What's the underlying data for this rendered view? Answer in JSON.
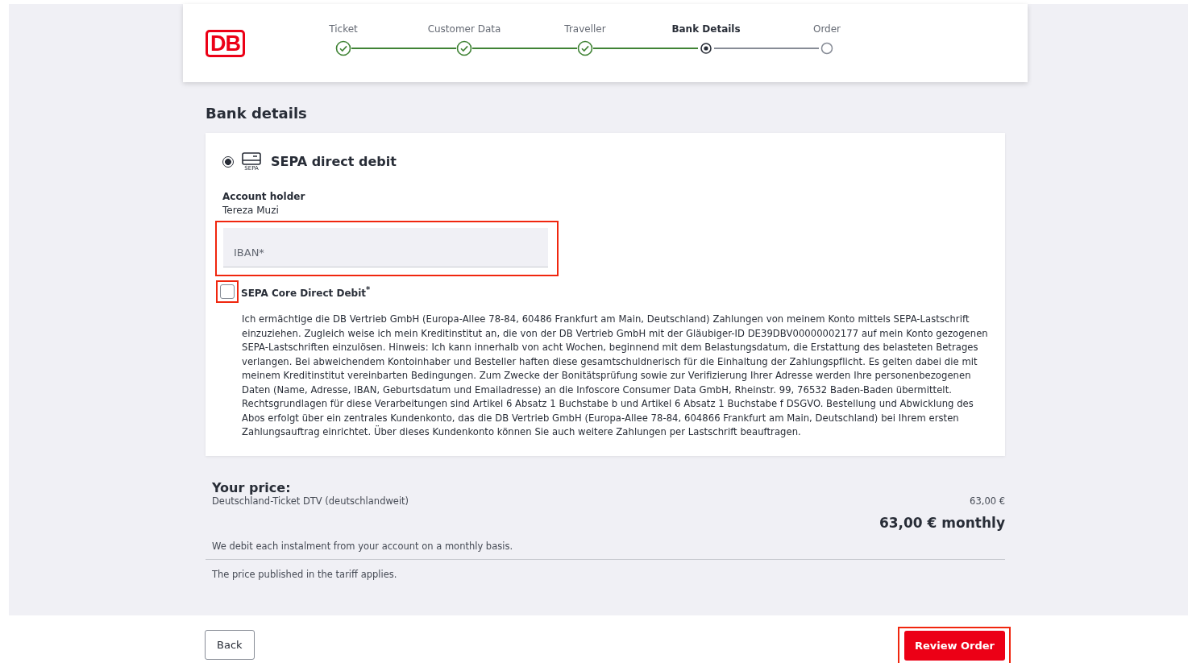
{
  "logo": "DB",
  "steps": [
    {
      "label": "Ticket",
      "completed": true,
      "selected": false
    },
    {
      "label": "Customer Data",
      "completed": true,
      "selected": false
    },
    {
      "label": "Traveller",
      "completed": true,
      "selected": false
    },
    {
      "label": "Bank Details",
      "completed": false,
      "selected": true
    },
    {
      "label": "Order",
      "completed": false,
      "selected": false
    }
  ],
  "heading": "Bank details",
  "payment": {
    "selected": true,
    "icon_caption": "SEPA",
    "label": "SEPA direct debit",
    "holder_label": "Account holder",
    "holder_value": "Tereza Muzi",
    "iban": {
      "placeholder": "IBAN*",
      "highlighted": true
    },
    "mandate": {
      "checked": false,
      "highlighted": true,
      "label": "SEPA Core Direct Debit$^{*}$",
      "text": "Ich ermächtige die DB Vertrieb GmbH (Europa-Allee 78-84, 60486 Frankfurt am Main, Deutschland) Zahlungen von meinem Konto mittels SEPA-Lastschrift einzuziehen. Zugleich weise ich mein Kreditinstitut an, die von der DB Vertrieb GmbH mit der Gläubiger-ID DE39DBV00000002177 auf mein Konto gezogenen SEPA-Lastschriften einzulösen. Hinweis: Ich kann innerhalb von acht Wochen, beginnend mit dem Belastungsdatum, die Erstattung des belasteten Betrages verlangen. Bei abweichendem Kontoinhaber und Besteller haften diese gesamtschuldnerisch für die Einhaltung der Zahlungspflicht. Es gelten dabei die mit meinem Kreditinstitut vereinbarten Bedingungen. Zum Zwecke der Bonitätsprüfung sowie zur Verifizierung Ihrer Adresse werden Ihre personenbezogenen Daten (Name, Adresse, IBAN, Geburtsdatum und Emailadresse) an die Infoscore Consumer Data GmbH, Rheinstr. 99, 76532 Baden-Baden übermittelt. Rechtsgrundlagen für diese Verarbeitungen sind Artikel 6 Absatz 1 Buchstabe b und Artikel 6 Absatz 1 Buchstabe f DSGVO. Bestellung und Abwicklung des Abos erfolgt über ein zentrales Kundenkonto, das die DB Vertrieb GmbH (Europa-Allee 78-84, 604866 Frankfurt am Main, Deutschland) bei Ihrem ersten Zahlungsauftrag einrichtet. Über dieses Kundenkonto können Sie auch weitere Zahlungen per Lastschrift beauftragen."
    }
  },
  "price": {
    "title": "Your price:",
    "item": "Deutschland-Ticket DTV (deutschlandweit)",
    "item_price": "63,00 €",
    "total": "63,00 € monthly",
    "note": "We debit each instalment from your account on a monthly basis.",
    "tariff_note": "The price published in the tariff applies."
  },
  "buttons": {
    "back": {
      "label": "Back"
    },
    "review": {
      "label": "Review Order",
      "highlighted": true
    }
  }
}
